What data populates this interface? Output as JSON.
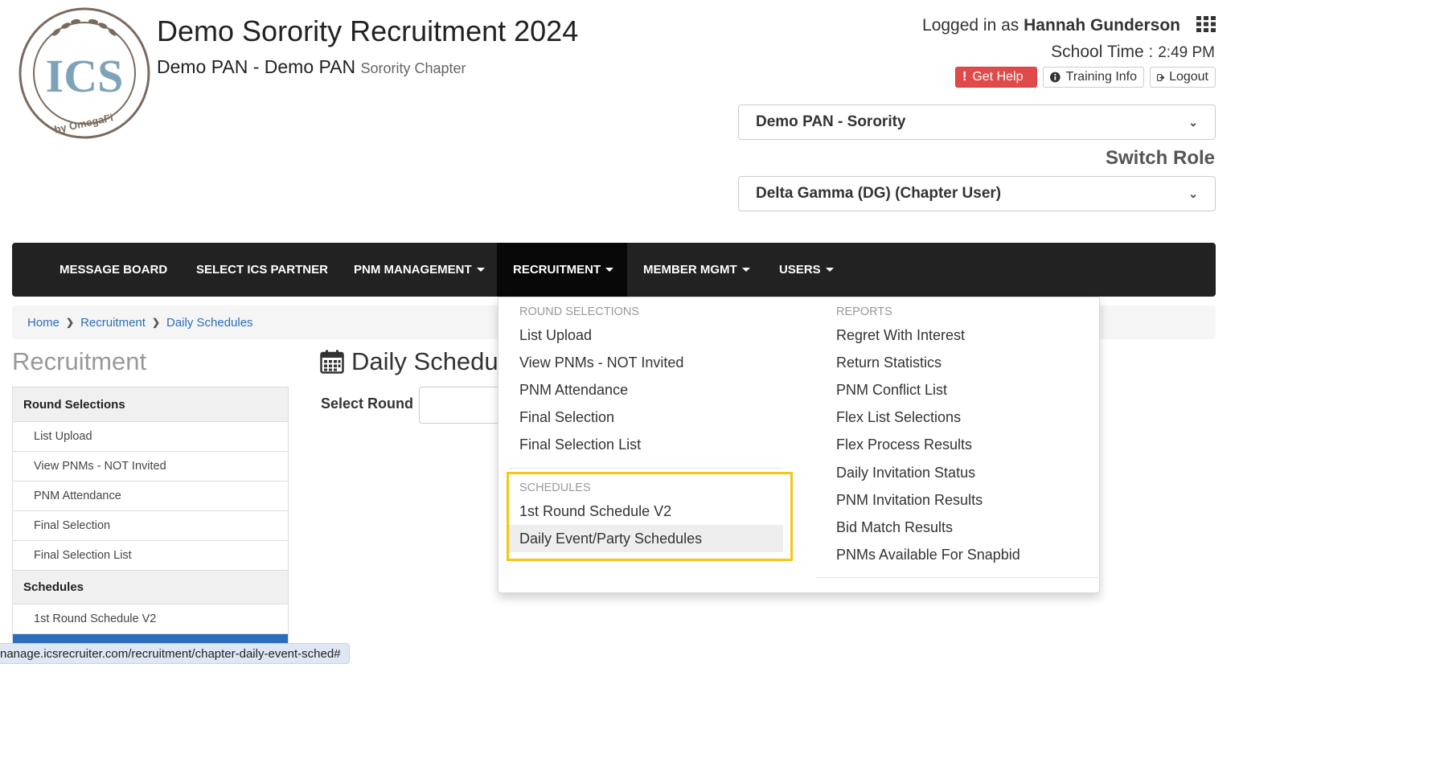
{
  "header": {
    "logo_text": "ICS",
    "logo_sub": "by OmegaFi",
    "title": "Demo Sorority Recruitment 2024",
    "subtitle": "Demo PAN - Demo PAN",
    "subtitle_suffix": "Sorority Chapter",
    "logged_in_prefix": "Logged in as",
    "user_name": "Hannah Gunderson",
    "school_time_label": "School Time :",
    "school_time_value": "2:49 PM",
    "buttons": {
      "help": "Get Help",
      "training": "Training Info",
      "logout": "Logout"
    },
    "org_select": "Demo PAN - Sorority",
    "switch_role_label": "Switch Role",
    "role_select": "Delta Gamma (DG) (Chapter User)"
  },
  "nav": {
    "items": [
      {
        "label": "MESSAGE BOARD"
      },
      {
        "label": "SELECT ICS PARTNER"
      },
      {
        "label": "PNM MANAGEMENT"
      },
      {
        "label": "RECRUITMENT"
      },
      {
        "label": "MEMBER MGMT"
      },
      {
        "label": "USERS"
      }
    ]
  },
  "breadcrumb": [
    "Home",
    "Recruitment",
    "Daily Schedules"
  ],
  "sidebar": {
    "title": "Recruitment",
    "sections": [
      {
        "heading": "Round Selections",
        "items": [
          "List Upload",
          "View PNMs - NOT Invited",
          "PNM Attendance",
          "Final Selection",
          "Final Selection List"
        ]
      },
      {
        "heading": "Schedules",
        "items": [
          "1st Round Schedule V2"
        ]
      }
    ]
  },
  "main": {
    "title": "Daily Schedu",
    "select_round_label": "Select Round"
  },
  "dropdown": {
    "round_selections_heading": "ROUND SELECTIONS",
    "round_selections": [
      "List Upload",
      "View PNMs - NOT Invited",
      "PNM Attendance",
      "Final Selection",
      "Final Selection List"
    ],
    "schedules_heading": "SCHEDULES",
    "schedules": [
      "1st Round Schedule V2",
      "Daily Event/Party Schedules"
    ],
    "reports_heading": "REPORTS",
    "reports": [
      "Regret With Interest",
      "Return Statistics",
      "PNM Conflict List",
      "Flex List Selections",
      "Flex Process Results",
      "Daily Invitation Status",
      "PNM Invitation Results",
      "Bid Match Results",
      "PNMs Available For Snapbid"
    ]
  },
  "statusbar": {
    "url": "nanage.icsrecruiter.com/recruitment/chapter-daily-event-sched#"
  },
  "colors": {
    "navbar_bg": "#222222",
    "help_button": "#e04a4a",
    "link": "#2a6ebb",
    "highlight_box": "#f5c518"
  }
}
